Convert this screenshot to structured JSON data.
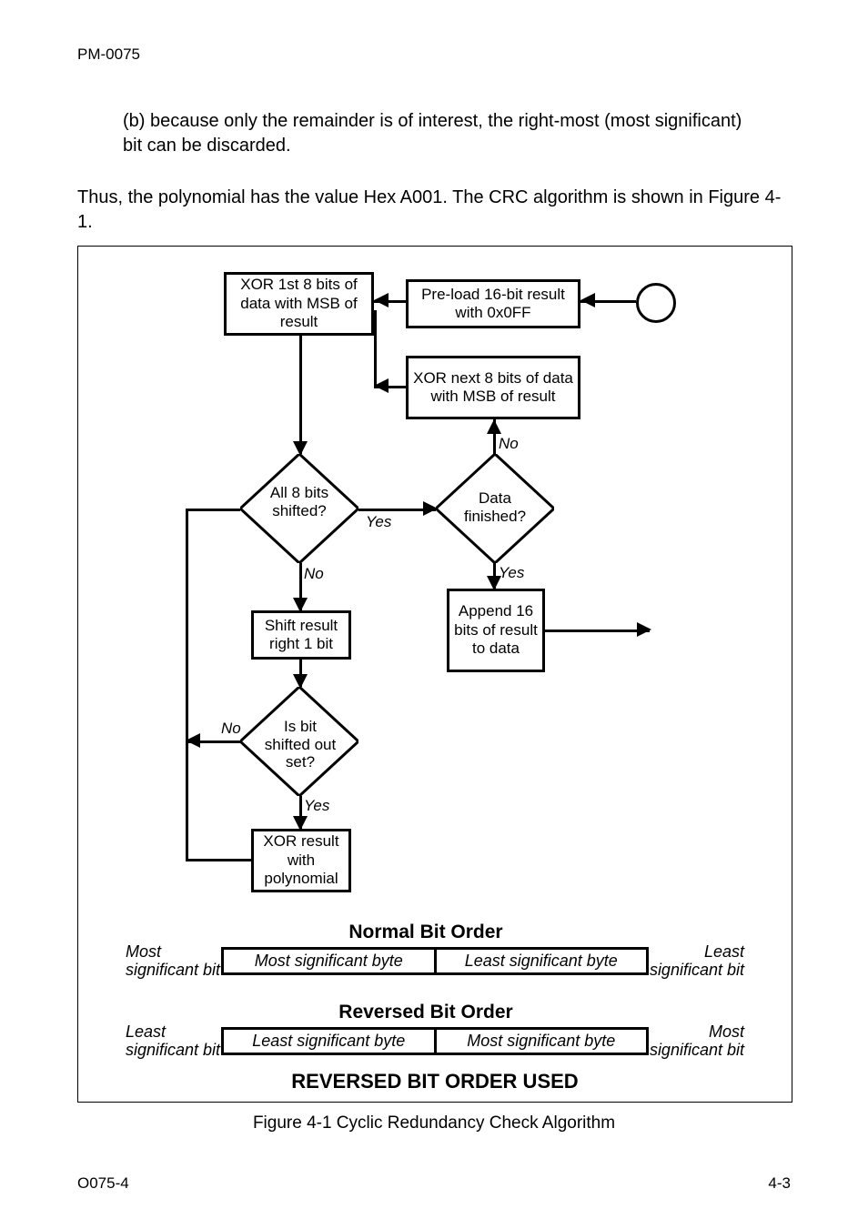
{
  "header": "PM-0075",
  "indent_b": "(b) because only the remainder is of interest, the right-most (most significant) bit can be discarded.",
  "para_main": "Thus, the polynomial has the value Hex A001. The CRC algorithm is shown in Figure 4-1.",
  "caption": "Figure 4-1      Cyclic Redundancy Check Algorithm",
  "footer_left": "O075-4",
  "footer_right": "4-3",
  "fc": {
    "preload": "Pre-load 16-bit result with 0x0FF",
    "xor1": "XOR 1st 8 bits of data with MSB of result",
    "xornext": "XOR next 8 bits of data with MSB of result",
    "all8": "All 8 bits shifted?",
    "datafin": "Data finished?",
    "shift": "Shift result right 1 bit",
    "append": "Append 16 bits of result to data",
    "isbit": "Is bit shifted out set?",
    "xorpoly": "XOR result with polynomial",
    "yes": "Yes",
    "no": "No"
  },
  "bits": {
    "normal_title": "Normal Bit Order",
    "reversed_title": "Reversed Bit Order",
    "msb_bit": "Most significant bit",
    "lsb_bit": "Least significant bit",
    "msb_byte": "Most significant byte",
    "lsb_byte": "Least significant byte",
    "rev_used": "REVERSED BIT ORDER USED"
  }
}
